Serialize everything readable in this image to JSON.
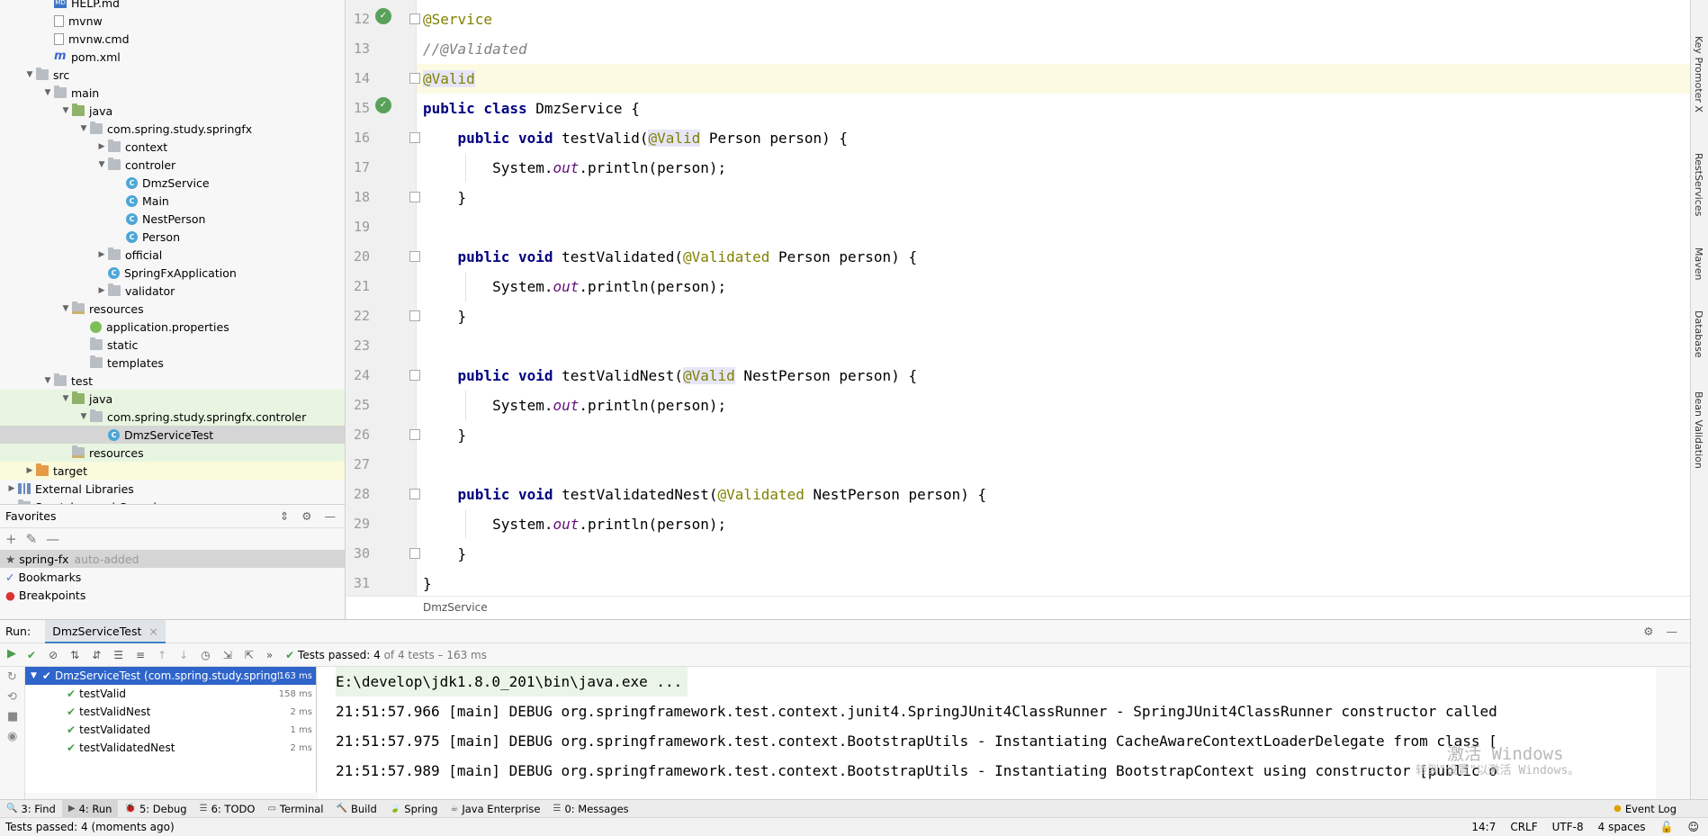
{
  "project_tree": [
    {
      "label": "HELP.md",
      "icon": "md",
      "indent": 2,
      "arrow": ""
    },
    {
      "label": "mvnw",
      "icon": "file",
      "indent": 2,
      "arrow": ""
    },
    {
      "label": "mvnw.cmd",
      "icon": "file",
      "indent": 2,
      "arrow": ""
    },
    {
      "label": "pom.xml",
      "icon": "m",
      "indent": 2,
      "arrow": ""
    },
    {
      "label": "src",
      "icon": "folder",
      "indent": 1,
      "arrow": "▼"
    },
    {
      "label": "main",
      "icon": "folder",
      "indent": 2,
      "arrow": "▼"
    },
    {
      "label": "java",
      "icon": "src",
      "indent": 3,
      "arrow": "▼"
    },
    {
      "label": "com.spring.study.springfx",
      "icon": "pkg",
      "indent": 4,
      "arrow": "▼"
    },
    {
      "label": "context",
      "icon": "pkg",
      "indent": 5,
      "arrow": "▶"
    },
    {
      "label": "controler",
      "icon": "pkg",
      "indent": 5,
      "arrow": "▼"
    },
    {
      "label": "DmzService",
      "icon": "class",
      "indent": 6,
      "arrow": ""
    },
    {
      "label": "Main",
      "icon": "class",
      "indent": 6,
      "arrow": ""
    },
    {
      "label": "NestPerson",
      "icon": "class",
      "indent": 6,
      "arrow": ""
    },
    {
      "label": "Person",
      "icon": "class",
      "indent": 6,
      "arrow": ""
    },
    {
      "label": "official",
      "icon": "pkg",
      "indent": 5,
      "arrow": "▶"
    },
    {
      "label": "SpringFxApplication",
      "icon": "class",
      "indent": 5,
      "arrow": ""
    },
    {
      "label": "validator",
      "icon": "pkg",
      "indent": 5,
      "arrow": "▶"
    },
    {
      "label": "resources",
      "icon": "res",
      "indent": 3,
      "arrow": "▼"
    },
    {
      "label": "application.properties",
      "icon": "props",
      "indent": 4,
      "arrow": ""
    },
    {
      "label": "static",
      "icon": "folder",
      "indent": 4,
      "arrow": ""
    },
    {
      "label": "templates",
      "icon": "folder",
      "indent": 4,
      "arrow": ""
    },
    {
      "label": "test",
      "icon": "folder",
      "indent": 2,
      "arrow": "▼"
    },
    {
      "label": "java",
      "icon": "src",
      "indent": 3,
      "arrow": "▼",
      "state": "hl"
    },
    {
      "label": "com.spring.study.springfx.controler",
      "icon": "pkg",
      "indent": 4,
      "arrow": "▼",
      "state": "hl"
    },
    {
      "label": "DmzServiceTest",
      "icon": "class",
      "indent": 5,
      "arrow": "",
      "state": "sel"
    },
    {
      "label": "resources",
      "icon": "res",
      "indent": 3,
      "arrow": "",
      "state": "hl"
    },
    {
      "label": "target",
      "icon": "target",
      "indent": 1,
      "arrow": "▶",
      "state": "hly"
    },
    {
      "label": "External Libraries",
      "icon": "lib",
      "indent": 0,
      "arrow": "▶"
    },
    {
      "label": "Scratches and Consoles",
      "icon": "folder",
      "indent": 0,
      "arrow": ""
    }
  ],
  "favorites": {
    "title": "Favorites",
    "items": [
      {
        "label": "spring-fx",
        "note": "auto-added",
        "icon": "★"
      },
      {
        "label": "Bookmarks",
        "note": "",
        "icon": "✓"
      },
      {
        "label": "Breakpoints",
        "note": "",
        "icon": "●"
      }
    ]
  },
  "editor": {
    "breadcrumb": "DmzService",
    "lines": [
      {
        "n": "12",
        "html": "<span class=\"ann\">@Service</span>"
      },
      {
        "n": "13",
        "html": "<span class=\"cmt\">//@Validated</span>"
      },
      {
        "n": "14",
        "html": "<span class=\"ann annbg\">@Valid</span>"
      },
      {
        "n": "15",
        "html": "<span class=\"kw\">public class</span> DmzService {"
      },
      {
        "n": "16",
        "html": "    <span class=\"kw\">public void</span> testValid(<span class=\"ann annbg\">@Valid</span> Person person) {"
      },
      {
        "n": "17",
        "html": "        System.<span class=\"fld\">out</span>.println(person);"
      },
      {
        "n": "18",
        "html": "    }"
      },
      {
        "n": "19",
        "html": ""
      },
      {
        "n": "20",
        "html": "    <span class=\"kw\">public void</span> testValidated(<span class=\"ann\">@Validated</span> Person person) {"
      },
      {
        "n": "21",
        "html": "        System.<span class=\"fld\">out</span>.println(person);"
      },
      {
        "n": "22",
        "html": "    }"
      },
      {
        "n": "23",
        "html": ""
      },
      {
        "n": "24",
        "html": "    <span class=\"kw\">public void</span> testValidNest(<span class=\"ann annbg\">@Valid</span> NestPerson person) {"
      },
      {
        "n": "25",
        "html": "        System.<span class=\"fld\">out</span>.println(person);"
      },
      {
        "n": "26",
        "html": "    }"
      },
      {
        "n": "27",
        "html": ""
      },
      {
        "n": "28",
        "html": "    <span class=\"kw\">public void</span> testValidatedNest(<span class=\"ann\">@Validated</span> NestPerson person) {"
      },
      {
        "n": "29",
        "html": "        System.<span class=\"fld\">out</span>.println(person);"
      },
      {
        "n": "30",
        "html": "    }"
      },
      {
        "n": "31",
        "html": "}"
      }
    ]
  },
  "right_tabs": [
    "Key Promoter X",
    "RestServices",
    "Maven",
    "Database",
    "Bean Validation"
  ],
  "run": {
    "label": "Run:",
    "tab": "DmzServiceTest",
    "status": "Tests passed:",
    "passed": "4",
    "summary": "of 4 tests – 163 ms",
    "tests": [
      {
        "name": "DmzServiceTest (com.spring.study.springf",
        "time": "163 ms",
        "root": true
      },
      {
        "name": "testValid",
        "time": "158 ms"
      },
      {
        "name": "testValidNest",
        "time": "2 ms"
      },
      {
        "name": "testValidated",
        "time": "1 ms"
      },
      {
        "name": "testValidatedNest",
        "time": "2 ms"
      }
    ],
    "console": [
      "E:\\develop\\jdk1.8.0_201\\bin\\java.exe ...",
      "21:51:57.966 [main] DEBUG org.springframework.test.context.junit4.SpringJUnit4ClassRunner - SpringJUnit4ClassRunner constructor called",
      "21:51:57.975 [main] DEBUG org.springframework.test.context.BootstrapUtils - Instantiating CacheAwareContextLoaderDelegate from class [",
      "21:51:57.989 [main] DEBUG org.springframework.test.context.BootstrapUtils - Instantiating BootstrapContext using constructor [public o"
    ],
    "watermark_1": "激活 Windows",
    "watermark_2": "转到\"设置\"以激活 Windows。"
  },
  "bottom_tools": [
    {
      "label": "3: Find",
      "icon": "🔍"
    },
    {
      "label": "4: Run",
      "icon": "▶",
      "active": true
    },
    {
      "label": "5: Debug",
      "icon": "🐞"
    },
    {
      "label": "6: TODO",
      "icon": "☰"
    },
    {
      "label": "Terminal",
      "icon": "▭"
    },
    {
      "label": "Build",
      "icon": "🔨"
    },
    {
      "label": "Spring",
      "icon": "🍃"
    },
    {
      "label": "Java Enterprise",
      "icon": "☕"
    },
    {
      "label": "0: Messages",
      "icon": "☰"
    }
  ],
  "event_log": "Event Log",
  "status": {
    "message": "Tests passed: 4 (moments ago)",
    "position": "14:7",
    "line_sep": "CRLF",
    "encoding": "UTF-8",
    "indent": "4 spaces"
  }
}
